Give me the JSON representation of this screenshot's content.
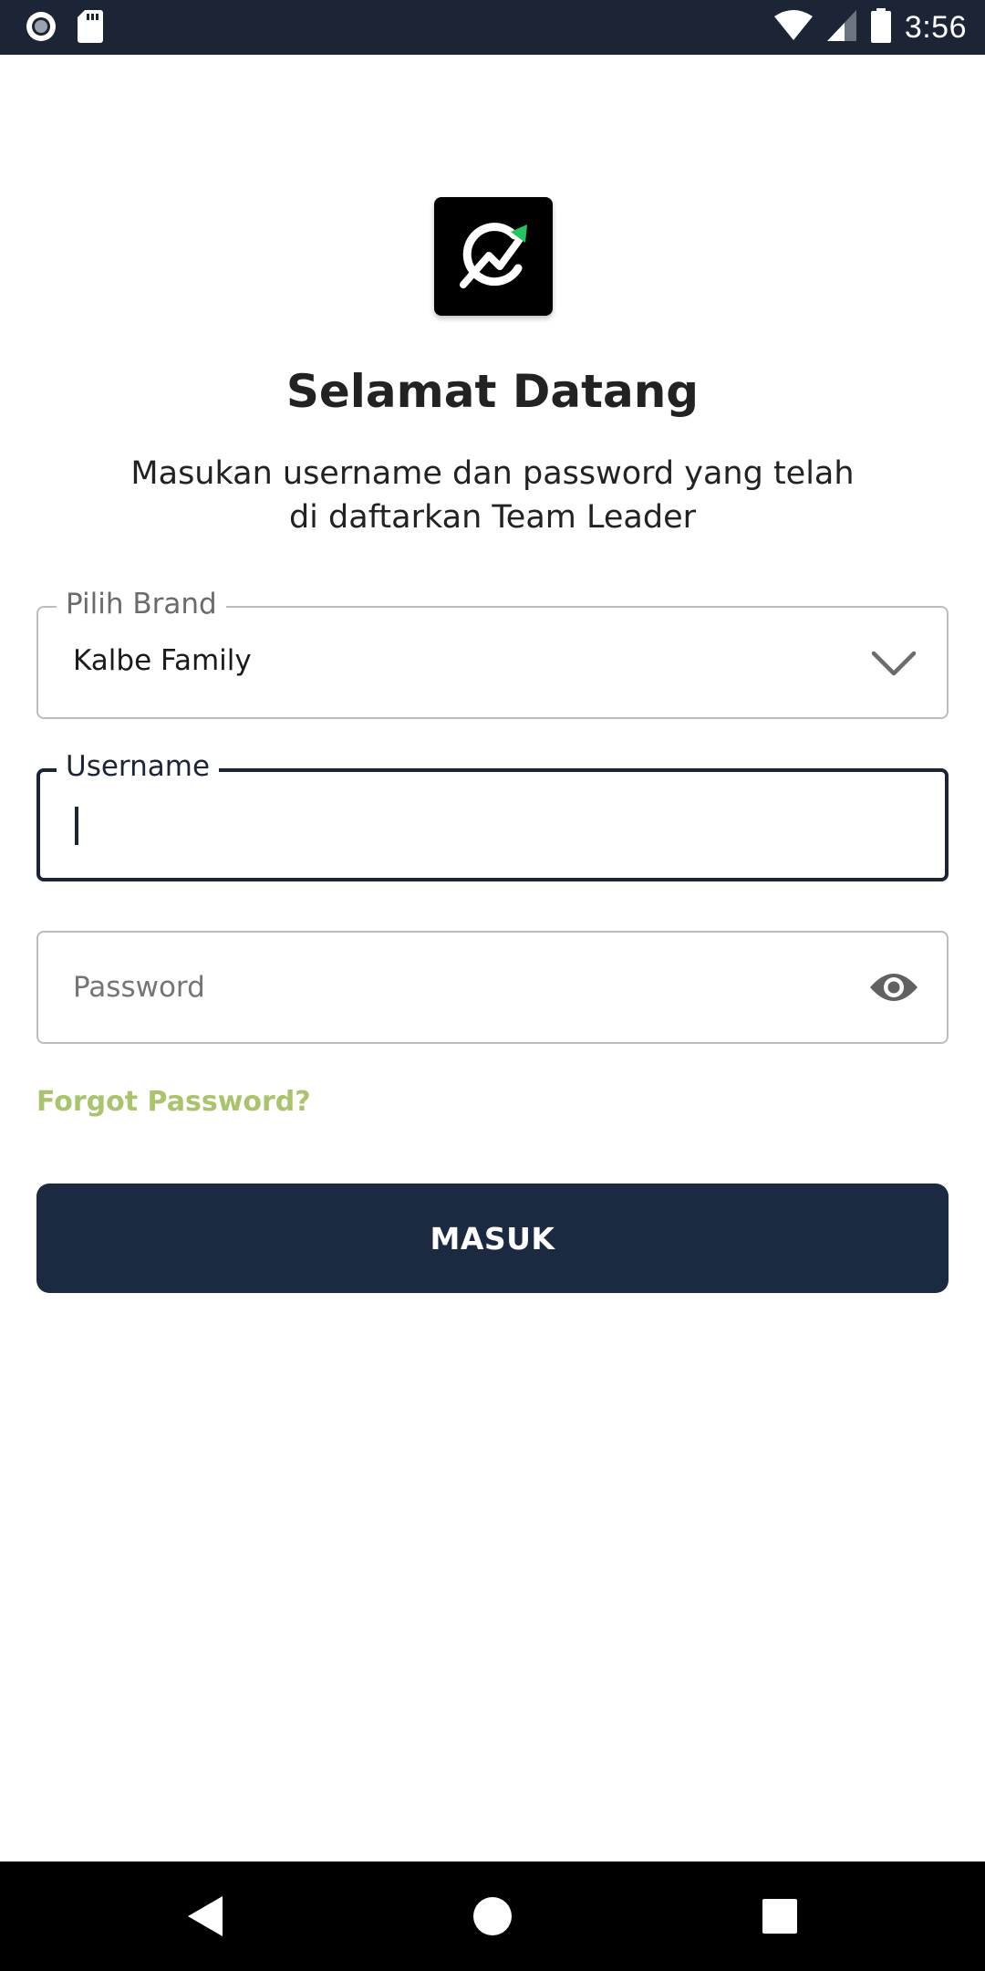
{
  "status_bar": {
    "time": "3:56",
    "icons": [
      "record-icon",
      "sd-card-icon",
      "wifi-icon",
      "signal-icon",
      "battery-icon"
    ]
  },
  "logo": {
    "icon": "trend-arrow-logo-icon",
    "accent": "#22c55e"
  },
  "welcome": {
    "title": "Selamat Datang",
    "subtitle": "Masukan username dan password yang telah di daftarkan Team Leader"
  },
  "form": {
    "brand": {
      "label": "Pilih Brand",
      "value": "Kalbe Family",
      "icon": "chevron-down-icon"
    },
    "username": {
      "label": "Username",
      "value": ""
    },
    "password": {
      "placeholder": "Password",
      "value": "",
      "icon": "eye-icon"
    },
    "forgot_label": "Forgot Password?",
    "submit_label": "MASUK"
  },
  "colors": {
    "primary": "#1b2a40",
    "link": "#a9c46c",
    "status_bar": "#1b2536"
  },
  "nav_bar": {
    "icons": [
      "back-icon",
      "home-icon",
      "recents-icon"
    ]
  }
}
